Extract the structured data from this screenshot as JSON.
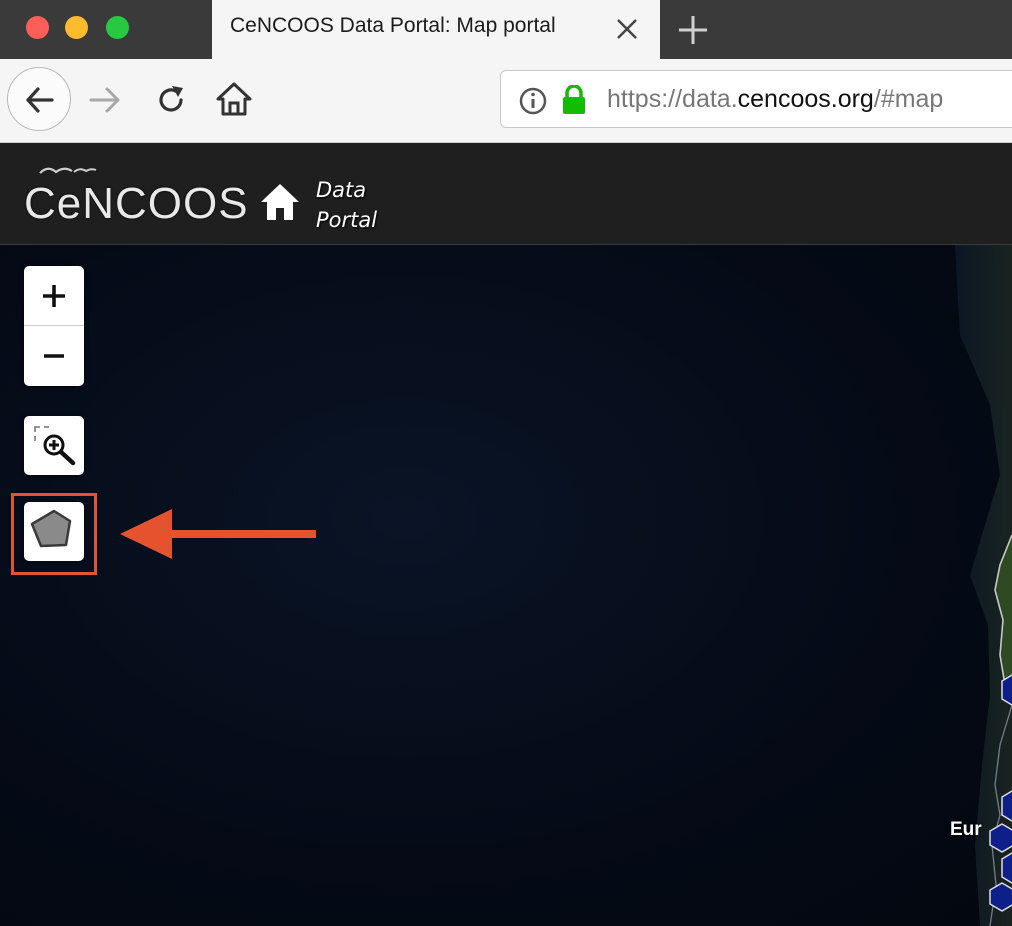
{
  "browser": {
    "tab_title": "CeNCOOS Data Portal: Map portal",
    "url_prefix": "https://data.",
    "url_domain": "cencoos.org",
    "url_suffix": "/#map"
  },
  "site": {
    "logo_text": "CeNCOOS",
    "portal_label_line1": "Data",
    "portal_label_line2": "Portal"
  },
  "map": {
    "zoom_in_label": "+",
    "zoom_out_label": "−",
    "place_label": "Eur",
    "station_color": "#0f1f8a",
    "highlight_color": "#e4532e"
  }
}
